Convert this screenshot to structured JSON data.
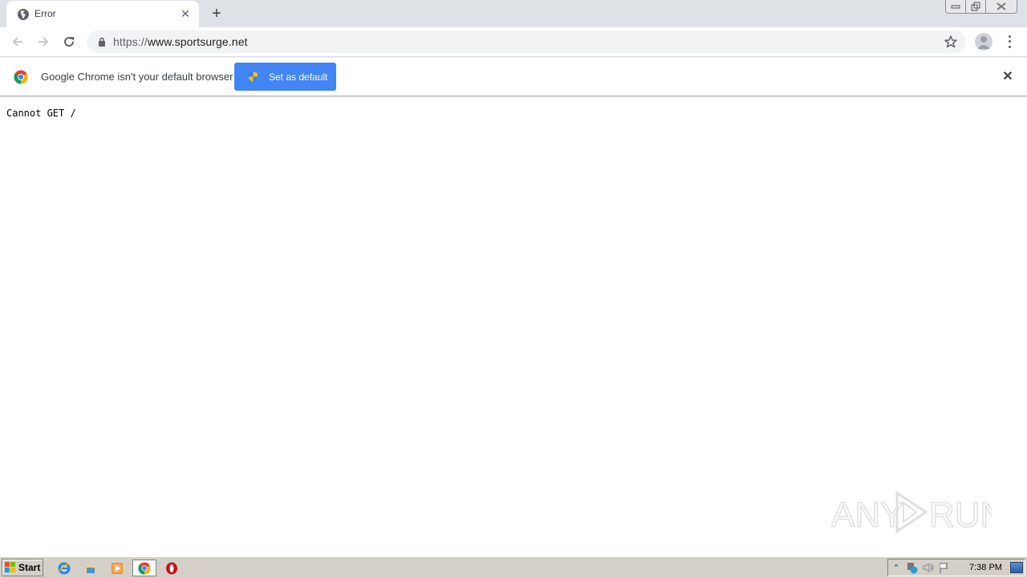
{
  "browser": {
    "tab": {
      "title": "Error",
      "favicon": "globe-icon"
    },
    "new_tab_label": "+",
    "url_scheme": "https://",
    "url_host": "www.sportsurge.net",
    "window_controls": [
      "minimize",
      "restore",
      "close"
    ]
  },
  "infobar": {
    "message": "Google Chrome isn't your default browser",
    "button_label": "Set as default",
    "close_label": "✕"
  },
  "page": {
    "body_text": "Cannot GET /"
  },
  "watermark": {
    "text": "ANY RUN"
  },
  "taskbar": {
    "start_label": "Start",
    "pinned": [
      "internet-explorer",
      "windows-explorer",
      "media-player",
      "chrome",
      "opera"
    ],
    "tray_icons": [
      "show-hidden",
      "network",
      "volume",
      "action-center-flag"
    ],
    "clock": "7:38 PM"
  },
  "colors": {
    "accent": "#4285f4",
    "tabstrip": "#dee1e6",
    "taskbar": "#d4d0c8"
  }
}
